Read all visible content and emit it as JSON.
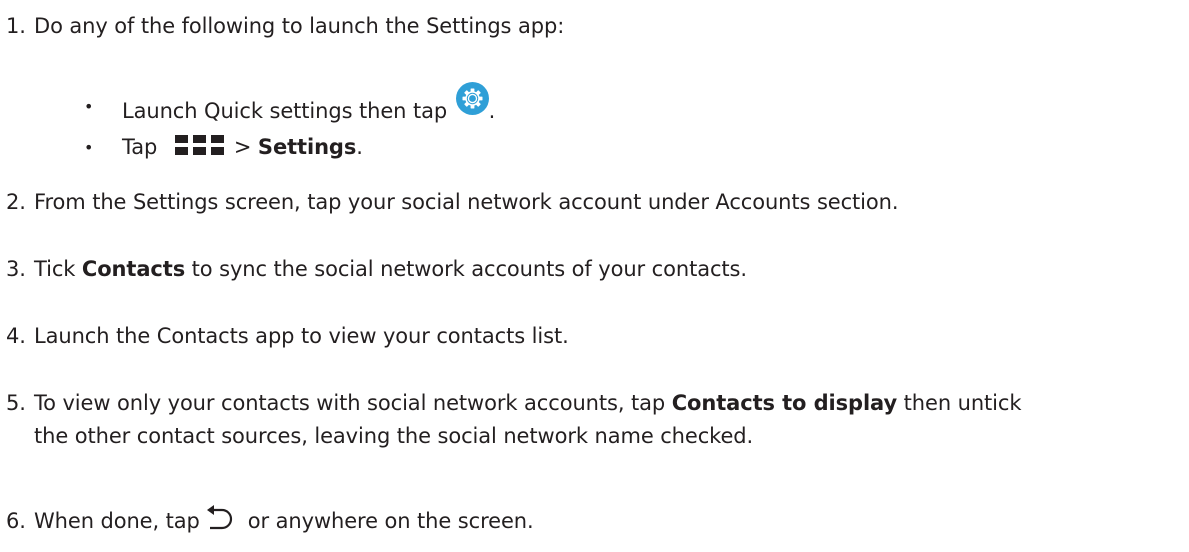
{
  "steps": {
    "s1": {
      "num": "1.",
      "text": "Do any of the following to launch the Settings app:",
      "bullets": {
        "b1": {
          "text_before": "Launch Quick settings then tap",
          "icon": "settings-gear-icon",
          "text_after": "."
        },
        "b2": {
          "text_before": "Tap",
          "icon": "all-apps-grid-icon",
          "text_mid": ">",
          "bold": "Settings",
          "text_after": "."
        }
      }
    },
    "s2": {
      "num": "2.",
      "text": "From the Settings screen, tap your social network account under Accounts section."
    },
    "s3": {
      "num": "3.",
      "text_before": "Tick",
      "bold": "Contacts",
      "text_after": "to sync the social network accounts of your contacts."
    },
    "s4": {
      "num": "4.",
      "text": "Launch the Contacts app to view your contacts list."
    },
    "s5": {
      "num": "5.",
      "text_before": "To view only your contacts with social network accounts, tap",
      "bold": "Contacts to display",
      "text_after": "then untick",
      "line2": "the other contact sources, leaving the social network name checked."
    },
    "s6": {
      "num": "6.",
      "text_before": "When done, tap",
      "icon": "back-arrow-icon",
      "text_after": "or anywhere on the screen."
    }
  },
  "bullet_char": "•",
  "colors": {
    "text": "#231f20",
    "gear_icon_bg": "#2f9fd7"
  }
}
